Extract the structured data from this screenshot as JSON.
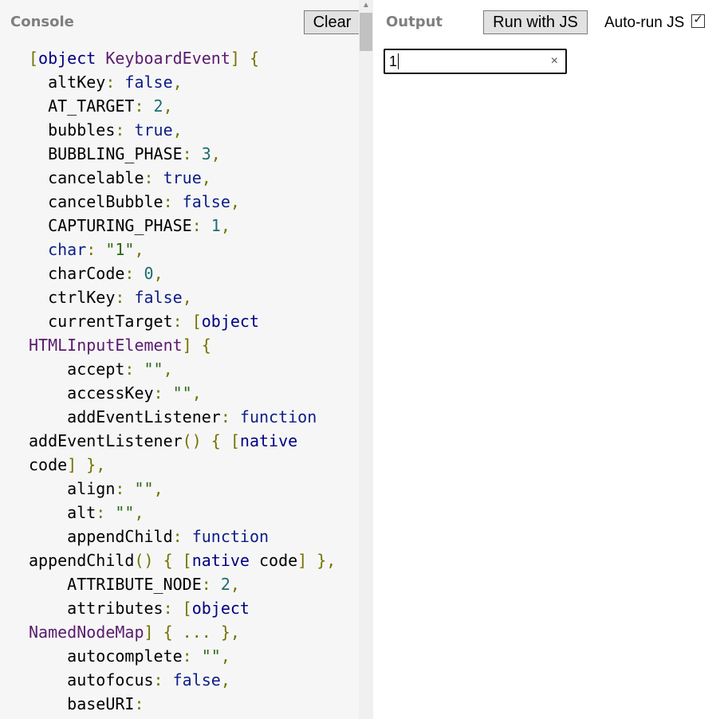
{
  "console": {
    "title": "Console",
    "clear_label": "Clear",
    "lines": [
      [
        {
          "t": "[",
          "c": "punc"
        },
        {
          "t": "object",
          "c": "obj"
        },
        {
          "t": " ",
          "c": "key"
        },
        {
          "t": "KeyboardEvent",
          "c": "type"
        },
        {
          "t": "] {",
          "c": "punc"
        }
      ],
      [
        {
          "t": "  altKey",
          "c": "key"
        },
        {
          "t": ": ",
          "c": "punc"
        },
        {
          "t": "false",
          "c": "kw"
        },
        {
          "t": ",",
          "c": "punc"
        }
      ],
      [
        {
          "t": "  AT_TARGET",
          "c": "key"
        },
        {
          "t": ": ",
          "c": "punc"
        },
        {
          "t": "2",
          "c": "num"
        },
        {
          "t": ",",
          "c": "punc"
        }
      ],
      [
        {
          "t": "  bubbles",
          "c": "key"
        },
        {
          "t": ": ",
          "c": "punc"
        },
        {
          "t": "true",
          "c": "kw"
        },
        {
          "t": ",",
          "c": "punc"
        }
      ],
      [
        {
          "t": "  BUBBLING_PHASE",
          "c": "key"
        },
        {
          "t": ": ",
          "c": "punc"
        },
        {
          "t": "3",
          "c": "num"
        },
        {
          "t": ",",
          "c": "punc"
        }
      ],
      [
        {
          "t": "  cancelable",
          "c": "key"
        },
        {
          "t": ": ",
          "c": "punc"
        },
        {
          "t": "true",
          "c": "kw"
        },
        {
          "t": ",",
          "c": "punc"
        }
      ],
      [
        {
          "t": "  cancelBubble",
          "c": "key"
        },
        {
          "t": ": ",
          "c": "punc"
        },
        {
          "t": "false",
          "c": "kw"
        },
        {
          "t": ",",
          "c": "punc"
        }
      ],
      [
        {
          "t": "  CAPTURING_PHASE",
          "c": "key"
        },
        {
          "t": ": ",
          "c": "punc"
        },
        {
          "t": "1",
          "c": "num"
        },
        {
          "t": ",",
          "c": "punc"
        }
      ],
      [
        {
          "t": "  char",
          "c": "kw"
        },
        {
          "t": ": ",
          "c": "punc"
        },
        {
          "t": "\"1\"",
          "c": "str"
        },
        {
          "t": ",",
          "c": "punc"
        }
      ],
      [
        {
          "t": "  charCode",
          "c": "key"
        },
        {
          "t": ": ",
          "c": "punc"
        },
        {
          "t": "0",
          "c": "num"
        },
        {
          "t": ",",
          "c": "punc"
        }
      ],
      [
        {
          "t": "  ctrlKey",
          "c": "key"
        },
        {
          "t": ": ",
          "c": "punc"
        },
        {
          "t": "false",
          "c": "kw"
        },
        {
          "t": ",",
          "c": "punc"
        }
      ],
      [
        {
          "t": "  currentTarget",
          "c": "key"
        },
        {
          "t": ": [",
          "c": "punc"
        },
        {
          "t": "object",
          "c": "obj"
        }
      ],
      [
        {
          "t": "HTMLInputElement",
          "c": "type"
        },
        {
          "t": "] {",
          "c": "punc"
        }
      ],
      [
        {
          "t": "    accept",
          "c": "key"
        },
        {
          "t": ": ",
          "c": "punc"
        },
        {
          "t": "\"\"",
          "c": "str"
        },
        {
          "t": ",",
          "c": "punc"
        }
      ],
      [
        {
          "t": "    accessKey",
          "c": "key"
        },
        {
          "t": ": ",
          "c": "punc"
        },
        {
          "t": "\"\"",
          "c": "str"
        },
        {
          "t": ",",
          "c": "punc"
        }
      ],
      [
        {
          "t": "    addEventListener",
          "c": "key"
        },
        {
          "t": ": ",
          "c": "punc"
        },
        {
          "t": "function",
          "c": "kw"
        }
      ],
      [
        {
          "t": "addEventListener",
          "c": "key"
        },
        {
          "t": "() { [",
          "c": "punc"
        },
        {
          "t": "native",
          "c": "obj"
        }
      ],
      [
        {
          "t": "code",
          "c": "key"
        },
        {
          "t": "] },",
          "c": "punc"
        }
      ],
      [
        {
          "t": "    align",
          "c": "key"
        },
        {
          "t": ": ",
          "c": "punc"
        },
        {
          "t": "\"\"",
          "c": "str"
        },
        {
          "t": ",",
          "c": "punc"
        }
      ],
      [
        {
          "t": "    alt",
          "c": "key"
        },
        {
          "t": ": ",
          "c": "punc"
        },
        {
          "t": "\"\"",
          "c": "str"
        },
        {
          "t": ",",
          "c": "punc"
        }
      ],
      [
        {
          "t": "    appendChild",
          "c": "key"
        },
        {
          "t": ": ",
          "c": "punc"
        },
        {
          "t": "function",
          "c": "kw"
        }
      ],
      [
        {
          "t": "appendChild",
          "c": "key"
        },
        {
          "t": "() { [",
          "c": "punc"
        },
        {
          "t": "native",
          "c": "obj"
        },
        {
          "t": " code",
          "c": "key"
        },
        {
          "t": "] },",
          "c": "punc"
        }
      ],
      [
        {
          "t": "    ATTRIBUTE_NODE",
          "c": "key"
        },
        {
          "t": ": ",
          "c": "punc"
        },
        {
          "t": "2",
          "c": "num"
        },
        {
          "t": ",",
          "c": "punc"
        }
      ],
      [
        {
          "t": "    attributes",
          "c": "key"
        },
        {
          "t": ": [",
          "c": "punc"
        },
        {
          "t": "object",
          "c": "obj"
        }
      ],
      [
        {
          "t": "NamedNodeMap",
          "c": "type"
        },
        {
          "t": "] { ... },",
          "c": "punc"
        }
      ],
      [
        {
          "t": "    autocomplete",
          "c": "key"
        },
        {
          "t": ": ",
          "c": "punc"
        },
        {
          "t": "\"\"",
          "c": "str"
        },
        {
          "t": ",",
          "c": "punc"
        }
      ],
      [
        {
          "t": "    autofocus",
          "c": "key"
        },
        {
          "t": ": ",
          "c": "punc"
        },
        {
          "t": "false",
          "c": "kw"
        },
        {
          "t": ",",
          "c": "punc"
        }
      ],
      [
        {
          "t": "    baseURI",
          "c": "key"
        },
        {
          "t": ":",
          "c": "punc"
        }
      ]
    ]
  },
  "output": {
    "title": "Output",
    "run_label": "Run with JS",
    "autorun_label": "Auto-run JS",
    "autorun_checked": true,
    "input_value": "1",
    "clear_input_icon": "close-icon"
  },
  "colors": {
    "console_bg": "#f6f6f6",
    "punctuation": "#737300",
    "object_keyword": "#000080",
    "type_name": "#5a1b6e",
    "literal_keyword": "#0d1e86",
    "number": "#1d6d6d",
    "string": "#2b6a12"
  }
}
